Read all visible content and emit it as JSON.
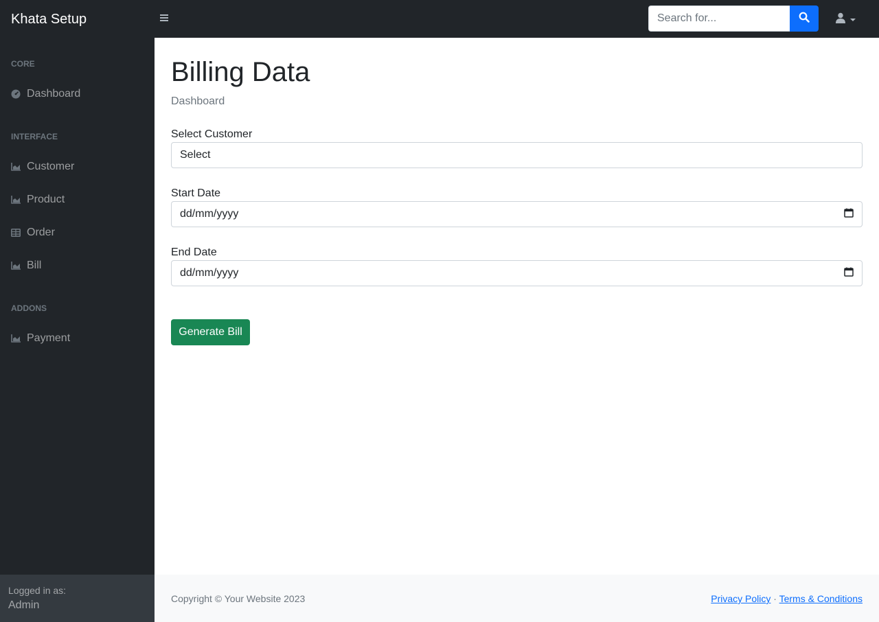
{
  "navbar": {
    "brand": "Khata Setup",
    "toggle_icon": "hamburger-icon",
    "search": {
      "placeholder": "Search for...",
      "button_icon": "search-icon"
    },
    "user_icon": "user-icon"
  },
  "sidebar": {
    "sections": [
      {
        "heading": "CORE",
        "items": [
          {
            "label": "Dashboard",
            "icon": "tachometer-icon"
          }
        ]
      },
      {
        "heading": "INTERFACE",
        "items": [
          {
            "label": "Customer",
            "icon": "chart-area-icon"
          },
          {
            "label": "Product",
            "icon": "chart-area-icon"
          },
          {
            "label": "Order",
            "icon": "table-icon"
          },
          {
            "label": "Bill",
            "icon": "chart-area-icon"
          }
        ]
      },
      {
        "heading": "ADDONS",
        "items": [
          {
            "label": "Payment",
            "icon": "chart-area-icon"
          }
        ]
      }
    ],
    "footer": {
      "logged_in_as": "Logged in as:",
      "user": "Admin"
    }
  },
  "main": {
    "title": "Billing Data",
    "breadcrumb": "Dashboard",
    "form": {
      "customer": {
        "label": "Select Customer",
        "value": "Select"
      },
      "start_date": {
        "label": "Start Date",
        "value": "dd/mm/yyyy"
      },
      "end_date": {
        "label": "End Date",
        "value": "dd/mm/yyyy"
      },
      "submit_label": "Generate Bill"
    }
  },
  "footer": {
    "copyright": "Copyright © Your Website 2023",
    "privacy": "Privacy Policy",
    "separator": "·",
    "terms": "Terms & Conditions"
  },
  "colors": {
    "nav_bg": "#212529",
    "primary": "#0d6efd",
    "success": "#198754",
    "footer_bg": "#f8f9fa"
  }
}
